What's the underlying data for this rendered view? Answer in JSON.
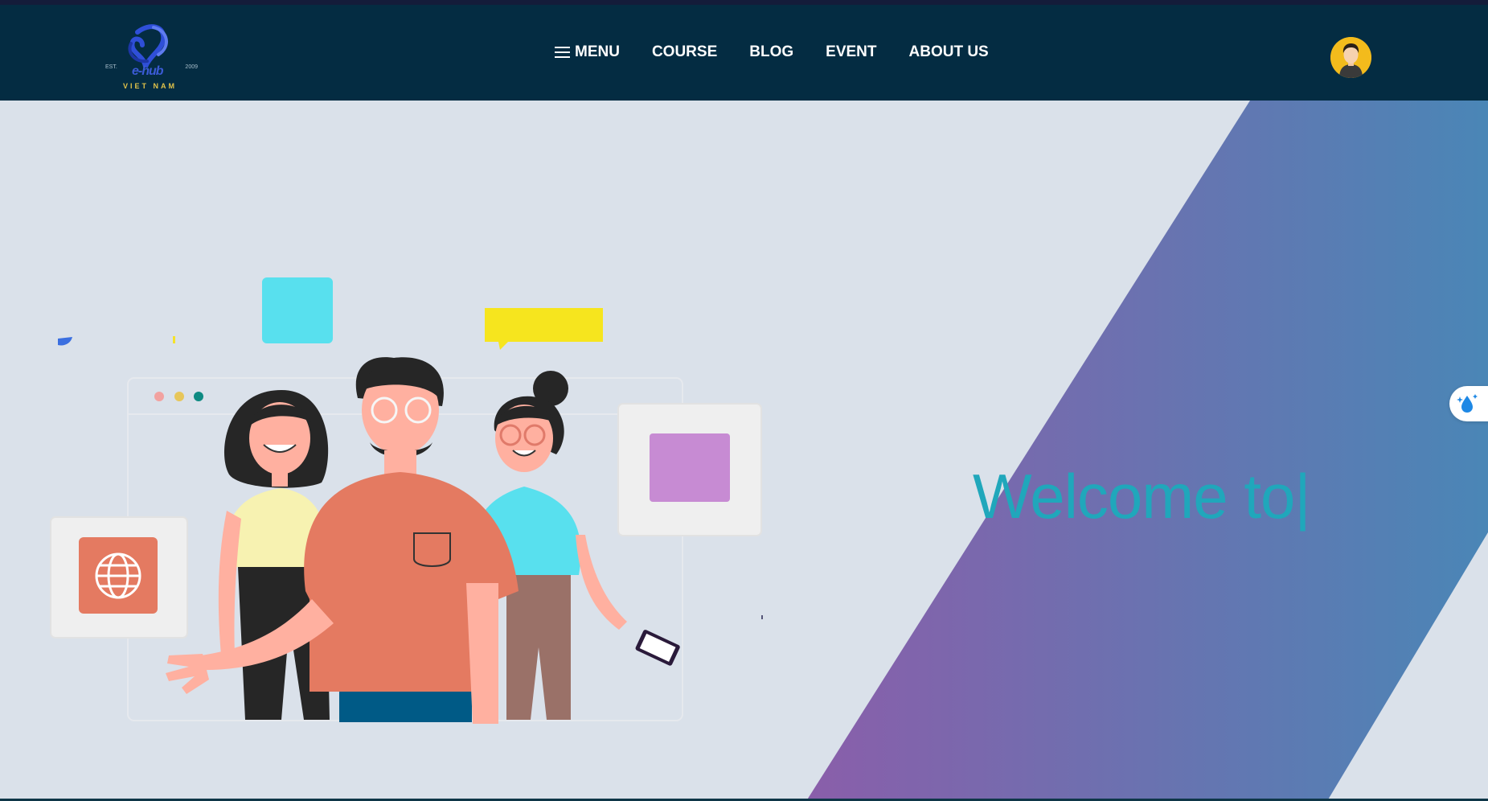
{
  "brand": {
    "name": "e-hub",
    "subtitle": "VIET NAM",
    "est": "EST.",
    "year": "2009"
  },
  "nav": {
    "items": [
      {
        "label": "MENU",
        "icon": "hamburger-icon"
      },
      {
        "label": "COURSE"
      },
      {
        "label": "BLOG"
      },
      {
        "label": "EVENT"
      },
      {
        "label": "ABOUT US"
      }
    ]
  },
  "hero": {
    "headline": "Welcome to",
    "cursor": "|"
  },
  "colors": {
    "navbar": "#042c42",
    "page_bg": "#dae1ea",
    "gradient_start": "#8a5eaa",
    "gradient_end": "#4a86b6",
    "headline": "#20a7bb"
  },
  "icons": {
    "user_avatar": "user-avatar-icon",
    "theme_toggle": "water-drop-sparkle-icon",
    "globe": "globe-icon"
  }
}
